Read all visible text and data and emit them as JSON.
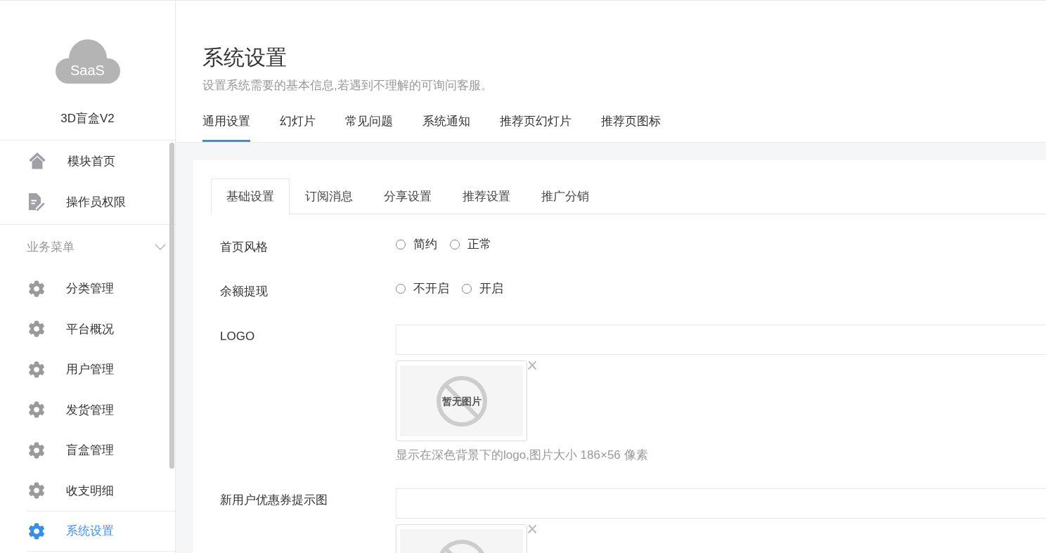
{
  "sidebar": {
    "logo_text": "SaaS",
    "app_name": "3D盲盒V2",
    "items": [
      {
        "label": "模块首页",
        "selected": false
      },
      {
        "label": "操作员权限",
        "selected": false
      }
    ],
    "groups": [
      {
        "title": "业务菜单",
        "expanded": true,
        "items": [
          {
            "label": "分类管理",
            "selected": false
          },
          {
            "label": "平台概况",
            "selected": false
          },
          {
            "label": "用户管理",
            "selected": false
          },
          {
            "label": "发货管理",
            "selected": false
          },
          {
            "label": "盲盒管理",
            "selected": false
          },
          {
            "label": "收支明细",
            "selected": false
          },
          {
            "label": "系统设置",
            "selected": true
          }
        ]
      }
    ]
  },
  "header": {
    "title": "系统设置",
    "subtitle": "设置系统需要的基本信息,若遇到不理解的可询问客服。",
    "tabs": [
      {
        "label": "通用设置",
        "selected": true
      },
      {
        "label": "幻灯片",
        "selected": false
      },
      {
        "label": "常见问题",
        "selected": false
      },
      {
        "label": "系统通知",
        "selected": false
      },
      {
        "label": "推荐页幻灯片",
        "selected": false
      },
      {
        "label": "推荐页图标",
        "selected": false
      }
    ]
  },
  "panel": {
    "tabs": [
      {
        "label": "基础设置",
        "selected": true
      },
      {
        "label": "订阅消息",
        "selected": false
      },
      {
        "label": "分享设置",
        "selected": false
      },
      {
        "label": "推荐设置",
        "selected": false
      },
      {
        "label": "推广分销",
        "selected": false
      }
    ],
    "rows": [
      {
        "label": "首页风格",
        "kind": "radio",
        "options": [
          {
            "label": "简约",
            "selected": false
          },
          {
            "label": "正常",
            "selected": false
          }
        ]
      },
      {
        "label": "余额提现",
        "kind": "radio",
        "options": [
          {
            "label": "不开启",
            "selected": false
          },
          {
            "label": "开启",
            "selected": false
          }
        ]
      },
      {
        "label": "LOGO",
        "kind": "upload",
        "image_text": "暂无图片",
        "help": "显示在深色背景下的logo,图片大小 186×56 像素"
      },
      {
        "label": "新用户优惠券提示图",
        "kind": "upload"
      }
    ]
  }
}
